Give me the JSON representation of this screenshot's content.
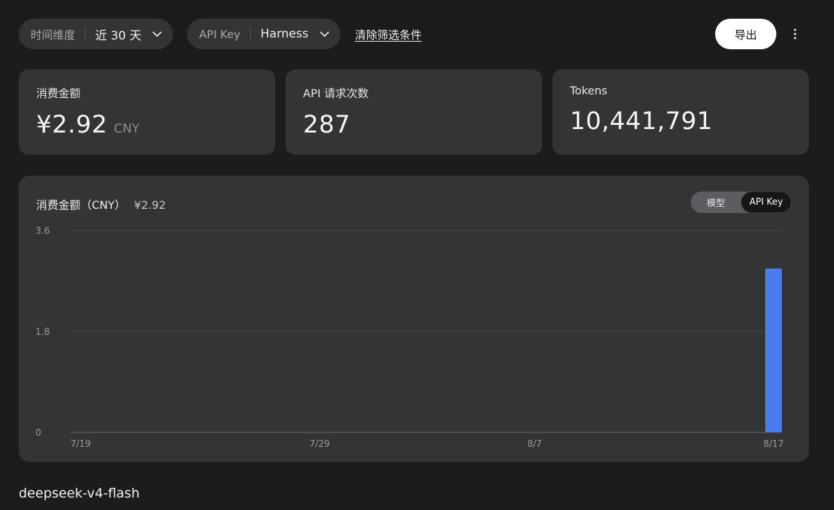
{
  "toolbar": {
    "time_filter": {
      "label": "时间维度",
      "value": "近 30 天"
    },
    "key_filter": {
      "label": "API Key",
      "value": "Harness"
    },
    "clear_label": "清除筛选条件",
    "export_label": "导出"
  },
  "stats": {
    "cost": {
      "title": "消费金额",
      "value": "¥2.92",
      "unit": "CNY"
    },
    "requests": {
      "title": "API 请求次数",
      "value": "287"
    },
    "tokens": {
      "title": "Tokens",
      "value": "10,441,791"
    }
  },
  "chart_panel": {
    "title": "消费金额（CNY）",
    "total": "¥2.92",
    "toggle": {
      "model_label": "模型",
      "key_label": "API Key",
      "active": "API Key"
    }
  },
  "chart_data": {
    "type": "bar",
    "title": "消费金额（CNY）",
    "x_labels": [
      "7/19",
      "7/29",
      "8/7",
      "8/17"
    ],
    "y_ticks": [
      "3.6",
      "1.8",
      "0"
    ],
    "ylim": [
      0,
      3.6
    ],
    "grid": true,
    "bar_color": "#4a7cf0",
    "series": [
      {
        "values": [
          {
            "x": "8/17",
            "y": 2.92
          }
        ]
      }
    ]
  },
  "section_label": "deepseek-v4-flash"
}
